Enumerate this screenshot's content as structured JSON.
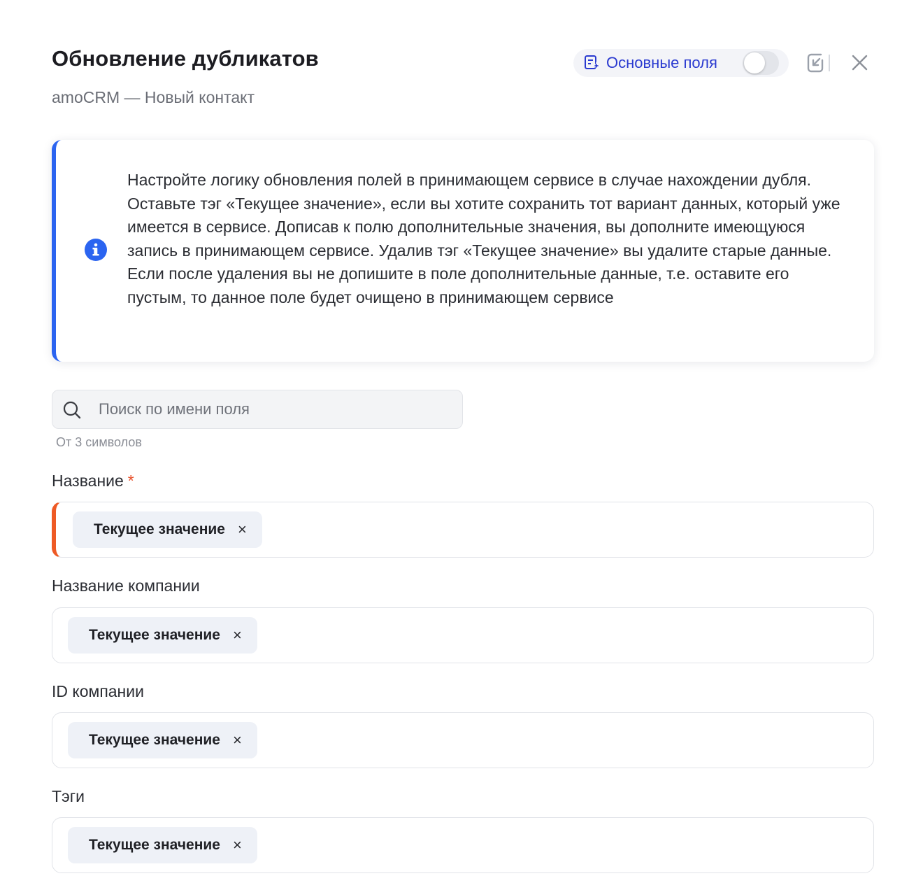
{
  "header": {
    "title": "Обновление дубликатов",
    "subtitle": "amoCRM — Новый контакт",
    "main_fields_label": "Основные поля",
    "main_fields_toggle_on": false
  },
  "info": {
    "text": "Настройте логику обновления полей в принимающем сервисе в случае нахождении дубля. Оставьте тэг «Текущее значение», если вы хотите сохранить тот вариант данных, который уже имеется в сервисе. Дописав к полю дополнительные значения, вы дополните имеющуюся запись в принимающем сервисе. Удалив тэг «Текущее значение» вы удалите старые данные. Если после удаления вы не допишите в поле дополнительные данные, т.е. оставите его пустым, то данное поле будет очищено в принимающем сервисе"
  },
  "search": {
    "placeholder": "Поиск по имени поля",
    "value": "",
    "hint": "От 3 символов"
  },
  "fields": [
    {
      "label": "Название",
      "required": true,
      "required_mark": "*",
      "tag": "Текущее значение",
      "tag_remove": "×"
    },
    {
      "label": "Название компании",
      "required": false,
      "tag": "Текущее значение",
      "tag_remove": "×"
    },
    {
      "label": "ID компании",
      "required": false,
      "tag": "Текущее значение",
      "tag_remove": "×"
    },
    {
      "label": "Тэги",
      "required": false,
      "tag": "Текущее значение",
      "tag_remove": "×"
    }
  ],
  "colors": {
    "accent": "#2b64f0",
    "link": "#2a3ad0",
    "error": "#ee5a25"
  }
}
